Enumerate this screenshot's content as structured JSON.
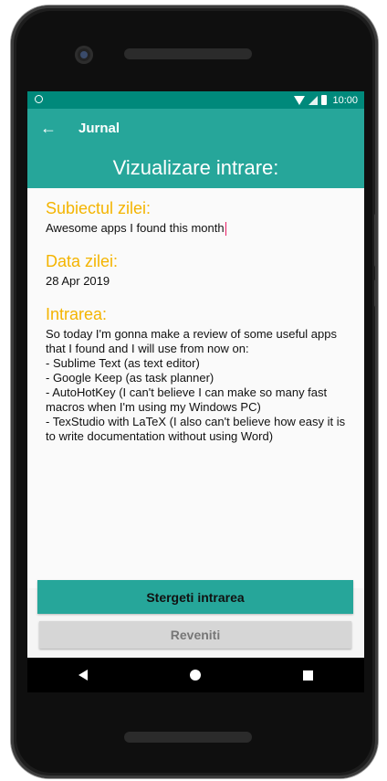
{
  "statusbar": {
    "time": "10:00"
  },
  "appbar": {
    "title": "Jurnal",
    "back_icon": "arrow-left-icon"
  },
  "header": {
    "title": "Vizualizare intrare:"
  },
  "fields": {
    "subject_label": "Subiectul zilei:",
    "subject_value": "Awesome apps I found this month",
    "date_label": "Data zilei:",
    "date_value": "28 Apr 2019",
    "entry_label": "Intrarea:",
    "entry_value": "So today I'm gonna make a review of some useful apps that I found and I will use from now on:\n- Sublime Text (as text editor)\n- Google Keep (as task planner)\n- AutoHotKey (I can't believe I can make so many fast macros when I'm using my Windows PC)\n- TexStudio with LaTeX (I also can't believe how easy it is to write documentation without using Word)"
  },
  "buttons": {
    "delete_label": "Stergeti intrarea",
    "back_label": "Reveniti"
  },
  "colors": {
    "primary": "#26a69a",
    "primary_dark": "#00897b",
    "accent_label": "#f4b400"
  }
}
